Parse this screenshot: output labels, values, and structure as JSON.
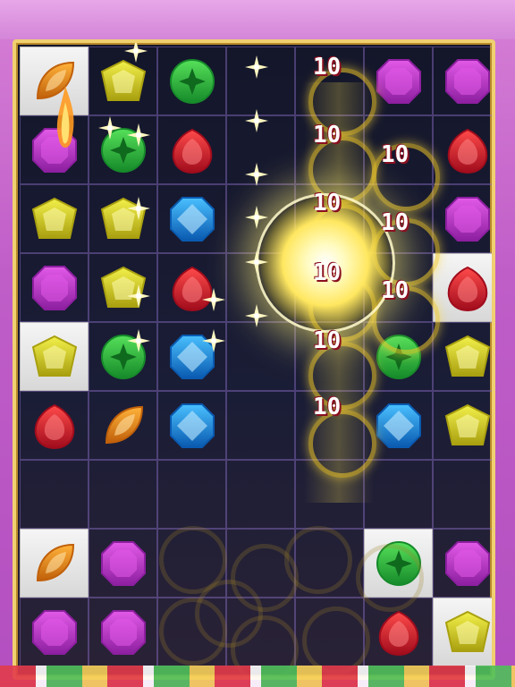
{
  "game": {
    "columns": 7,
    "rows": 9,
    "cells": [
      [
        {
          "gem": "orange-leaf",
          "tile": true
        },
        {
          "gem": "yellow-pentagon"
        },
        {
          "gem": "green-circle"
        },
        {
          "gem": ""
        },
        {
          "gem": ""
        },
        {
          "gem": "purple-octagon"
        },
        {
          "gem": "purple-octagon"
        }
      ],
      [
        {
          "gem": "purple-octagon"
        },
        {
          "gem": "green-circle"
        },
        {
          "gem": "red-drop"
        },
        {
          "gem": ""
        },
        {
          "gem": ""
        },
        {
          "gem": ""
        },
        {
          "gem": "red-drop"
        }
      ],
      [
        {
          "gem": "yellow-pentagon"
        },
        {
          "gem": "yellow-pentagon"
        },
        {
          "gem": "blue-octagon"
        },
        {
          "gem": ""
        },
        {
          "gem": ""
        },
        {
          "gem": ""
        },
        {
          "gem": "purple-octagon"
        }
      ],
      [
        {
          "gem": "purple-octagon"
        },
        {
          "gem": "yellow-pentagon"
        },
        {
          "gem": "red-drop"
        },
        {
          "gem": ""
        },
        {
          "gem": ""
        },
        {
          "gem": ""
        },
        {
          "gem": "red-drop",
          "tile": true
        }
      ],
      [
        {
          "gem": "yellow-pentagon",
          "tile": true
        },
        {
          "gem": "green-circle"
        },
        {
          "gem": "blue-octagon"
        },
        {
          "gem": ""
        },
        {
          "gem": ""
        },
        {
          "gem": "green-circle"
        },
        {
          "gem": "yellow-pentagon"
        }
      ],
      [
        {
          "gem": "red-drop"
        },
        {
          "gem": "orange-leaf"
        },
        {
          "gem": "blue-octagon"
        },
        {
          "gem": ""
        },
        {
          "gem": ""
        },
        {
          "gem": "blue-octagon"
        },
        {
          "gem": "yellow-pentagon"
        }
      ],
      [
        {
          "gem": ""
        },
        {
          "gem": ""
        },
        {
          "gem": ""
        },
        {
          "gem": ""
        },
        {
          "gem": ""
        },
        {
          "gem": ""
        },
        {
          "gem": ""
        }
      ],
      [
        {
          "gem": "orange-leaf",
          "tile": true
        },
        {
          "gem": "purple-octagon"
        },
        {
          "gem": ""
        },
        {
          "gem": ""
        },
        {
          "gem": ""
        },
        {
          "gem": "green-circle",
          "tile": true
        },
        {
          "gem": "purple-octagon"
        }
      ],
      [
        {
          "gem": "purple-octagon"
        },
        {
          "gem": "purple-octagon"
        },
        {
          "gem": ""
        },
        {
          "gem": ""
        },
        {
          "gem": ""
        },
        {
          "gem": "red-drop"
        },
        {
          "gem": "yellow-pentagon",
          "tile": true
        }
      ]
    ]
  },
  "score_popups": [
    {
      "text": "10"
    },
    {
      "text": "10"
    },
    {
      "text": "10"
    },
    {
      "text": "10"
    },
    {
      "text": "10"
    },
    {
      "text": "10"
    },
    {
      "text": "10"
    },
    {
      "text": "10"
    },
    {
      "text": "10"
    }
  ],
  "colors": {
    "board_border": "#f0d070",
    "board_bg": "#14162a",
    "frame_bg": "#c05ec8",
    "score_text": "#ffffff",
    "score_outline": "#8a1020",
    "burst_glow": "#ffe760"
  },
  "gem_colors": {
    "purple-octagon": [
      "#e25ae8",
      "#8d1fa0"
    ],
    "yellow-pentagon": [
      "#f2f04a",
      "#a9a010"
    ],
    "green-circle": [
      "#56e05a",
      "#168a2a"
    ],
    "red-drop": [
      "#ff4a4a",
      "#a00c1c"
    ],
    "blue-octagon": [
      "#4ac0ff",
      "#0a5ab0"
    ],
    "orange-leaf": [
      "#ffb23a",
      "#c0600a"
    ]
  }
}
